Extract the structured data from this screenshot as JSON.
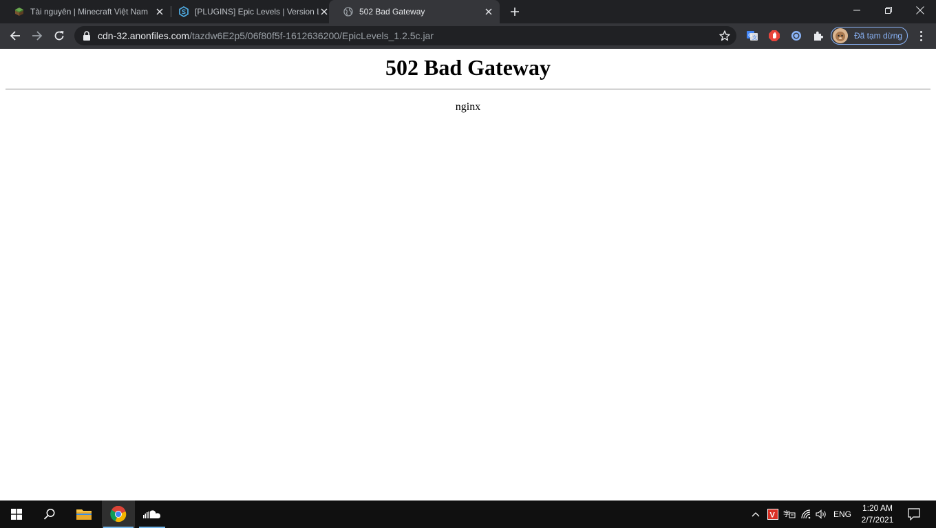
{
  "browser": {
    "tabs": [
      {
        "title": "Tài nguyên | Minecraft Việt Nam",
        "favicon": "minecraft-grass-block-icon",
        "active": false
      },
      {
        "title": "[PLUGINS] Epic Levels | Version La",
        "favicon": "spigot-hexagon-icon",
        "active": false
      },
      {
        "title": "502 Bad Gateway",
        "favicon": "globe-icon",
        "active": true
      }
    ],
    "address_bar": {
      "host": "cdn-32.anonfiles.com",
      "path": "/tazdw6E2p5/06f80f5f-1612636200/EpicLevels_1.2.5c.jar"
    },
    "profile_label": "Đã tạm dừng"
  },
  "page": {
    "heading": "502 Bad Gateway",
    "server": "nginx"
  },
  "taskbar": {
    "language": "ENG",
    "time": "1:20 AM",
    "date": "2/7/2021"
  },
  "colors": {
    "tabstrip": "#202124",
    "toolbar": "#35363a",
    "accent": "#8ab4f8",
    "taskbar": "#101010"
  }
}
